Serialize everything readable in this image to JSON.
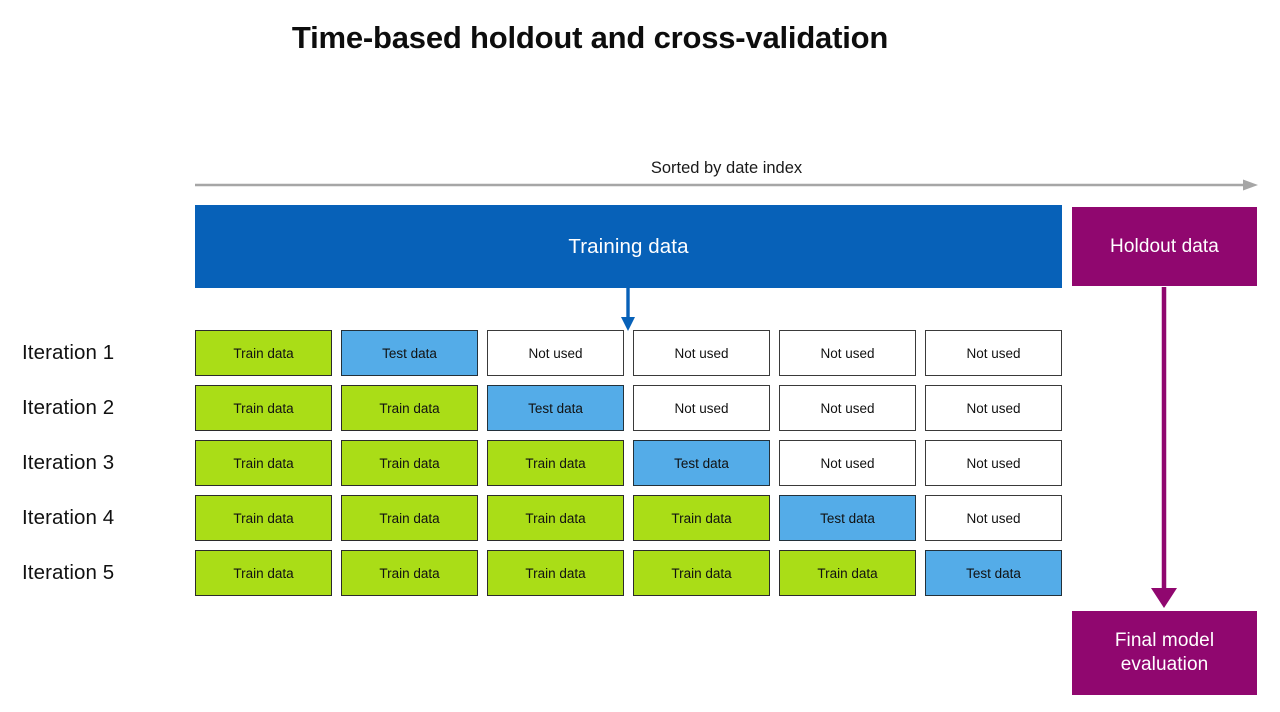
{
  "page_title": "Time-based holdout and cross-validation",
  "axis": {
    "caption": "Sorted by date index",
    "arrow_icon": "right-arrow-icon",
    "color": "#a6a6a6"
  },
  "top_bars": {
    "training": {
      "label": "Training data",
      "color": "#0761b8"
    },
    "holdout": {
      "label": "Holdout data",
      "color": "#90076f"
    }
  },
  "split_arrow": {
    "icon": "down-arrow-icon",
    "color": "#0761b8"
  },
  "eval_arrow": {
    "icon": "down-arrow-icon",
    "color": "#90076f"
  },
  "legend_colors": {
    "train": "#aadd17",
    "test": "#54ace8",
    "unused": "#ffffff",
    "training_bar": "#0761b8",
    "holdout": "#90076f",
    "axis": "#a6a6a6"
  },
  "cell_labels": {
    "train": "Train data",
    "test": "Test data",
    "unused": "Not used"
  },
  "iterations": [
    {
      "label": "Iteration 1",
      "cells": [
        "train",
        "test",
        "unused",
        "unused",
        "unused",
        "unused"
      ]
    },
    {
      "label": "Iteration 2",
      "cells": [
        "train",
        "train",
        "test",
        "unused",
        "unused",
        "unused"
      ]
    },
    {
      "label": "Iteration 3",
      "cells": [
        "train",
        "train",
        "train",
        "test",
        "unused",
        "unused"
      ]
    },
    {
      "label": "Iteration 4",
      "cells": [
        "train",
        "train",
        "train",
        "train",
        "test",
        "unused"
      ]
    },
    {
      "label": "Iteration 5",
      "cells": [
        "train",
        "train",
        "train",
        "train",
        "train",
        "test"
      ]
    }
  ],
  "final_eval": {
    "line1": "Final model",
    "line2": "evaluation",
    "color": "#90076f"
  }
}
